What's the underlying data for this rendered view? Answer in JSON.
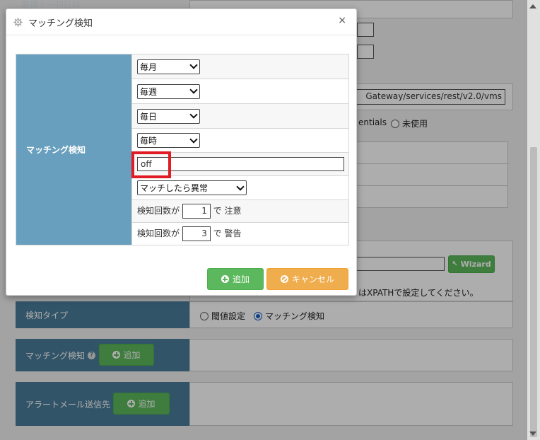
{
  "background": {
    "top_clip_text": "取得 | ー刊日時",
    "url_text": "Gateway/services/rest/v2.0/vms",
    "credentials_text": "entials",
    "unused_label": "未使用",
    "wizard_label": "Wizard",
    "xpath_note": "はXPATHで設定してください。",
    "detect_type_label": "検知タイプ",
    "threshold_label": "閾値設定",
    "matching_label": "マッチング検知",
    "matching_section_label": "マッチング検知",
    "add_label": "追加",
    "alert_mail_label": "アラートメール送信先",
    "alert_add_label": "追加"
  },
  "dialog": {
    "title": "マッチング検知",
    "close_symbol": "×",
    "row_label": "マッチング検知",
    "selects": {
      "month": "毎月",
      "week": "毎週",
      "day": "毎日",
      "hour": "毎時"
    },
    "text_value": "off",
    "match_select": "マッチしたら異常",
    "caution": {
      "prefix": "検知回数が",
      "value": "1",
      "mid": "で",
      "suffix": "注意"
    },
    "warning": {
      "prefix": "検知回数が",
      "value": "3",
      "mid": "で",
      "suffix": "警告"
    },
    "add_button": "追加",
    "cancel_button": "キャンセル"
  },
  "colors": {
    "label_bg": "#689fbe",
    "add_green": "#5cb85c",
    "cancel_orange": "#f0ad4e",
    "highlight_red": "#e01b24"
  }
}
